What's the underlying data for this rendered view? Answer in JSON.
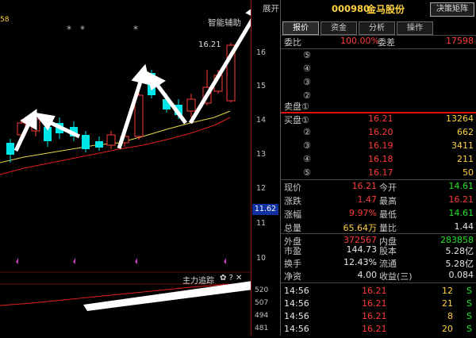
{
  "header": {
    "code": "000980",
    "name": "金马股份",
    "decision_btn": "决策矩阵",
    "side_text": "展开"
  },
  "tabs": [
    "报价",
    "资金",
    "分析",
    "操作"
  ],
  "chart_labels": {
    "ma_label": "58",
    "smart_assist": "智能辅助",
    "high_mark": "16.21",
    "main_track": "主力追踪",
    "track_icons": "✿ ? ✕",
    "current_price": "11.62",
    "stars": [
      "*",
      "*",
      "*"
    ]
  },
  "price_axis": [
    "16",
    "15",
    "14",
    "13",
    "12",
    "11",
    "10"
  ],
  "volume_axis": [
    "520",
    "507",
    "494",
    "481"
  ],
  "quote": {
    "weibi_label": "委比",
    "weibi": "100.00%",
    "weicha_label": "委差",
    "weicha": "17598",
    "sell_labels": [
      "⑤",
      "④",
      "③",
      "②",
      "卖盘①"
    ],
    "buy": [
      {
        "label": "买盘①",
        "price": "16.21",
        "vol": "13264"
      },
      {
        "label": "②",
        "price": "16.20",
        "vol": "662"
      },
      {
        "label": "③",
        "price": "16.19",
        "vol": "3411"
      },
      {
        "label": "④",
        "price": "16.18",
        "vol": "211"
      },
      {
        "label": "⑤",
        "price": "16.17",
        "vol": "50"
      }
    ],
    "stats": [
      {
        "l1": "现价",
        "v1": "16.21",
        "c1": "red",
        "l2": "今开",
        "v2": "14.61",
        "c2": "green"
      },
      {
        "l1": "涨跌",
        "v1": "1.47",
        "c1": "red",
        "l2": "最高",
        "v2": "16.21",
        "c2": "red"
      },
      {
        "l1": "涨幅",
        "v1": "9.97%",
        "c1": "red",
        "l2": "最低",
        "v2": "14.61",
        "c2": "green"
      },
      {
        "l1": "总量",
        "v1": "65.64万",
        "c1": "yellow",
        "l2": "量比",
        "v2": "1.44",
        "c2": "white"
      },
      {
        "l1": "外盘",
        "v1": "372567",
        "c1": "red",
        "l2": "内盘",
        "v2": "283858",
        "c2": "green"
      },
      {
        "l1": "市盈",
        "v1": "144.73",
        "c1": "white",
        "l2": "股本",
        "v2": "5.28亿",
        "c2": "white"
      },
      {
        "l1": "换手",
        "v1": "12.43%",
        "c1": "white",
        "l2": "流通",
        "v2": "5.28亿",
        "c2": "white"
      },
      {
        "l1": "净资",
        "v1": "4.00",
        "c1": "white",
        "l2": "收益(三)",
        "v2": "0.084",
        "c2": "white"
      }
    ],
    "ticks": [
      {
        "time": "14:56",
        "price": "16.21",
        "vol": "12",
        "dir": "S"
      },
      {
        "time": "14:56",
        "price": "16.21",
        "vol": "21",
        "dir": "S"
      },
      {
        "time": "14:56",
        "price": "16.21",
        "vol": "8",
        "dir": "S"
      },
      {
        "time": "14:56",
        "price": "16.21",
        "vol": "20",
        "dir": "S"
      }
    ]
  },
  "colors": {
    "up": "#ff3b3b",
    "down": "#00e5e5",
    "ma_yellow": "#e8d84a",
    "ma_red": "#e02020",
    "arrow": "#ffffff"
  }
}
